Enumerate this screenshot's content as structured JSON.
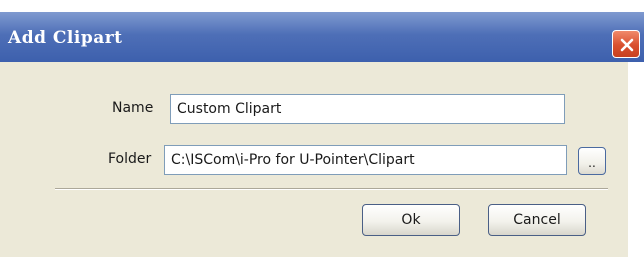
{
  "dialog": {
    "title": "Add Clipart",
    "close_icon": "close-icon",
    "name_label": "Name",
    "name_value": "Custom Clipart",
    "folder_label": "Folder",
    "folder_value": "C:\\ISCom\\i-Pro for U-Pointer\\Clipart",
    "browse_label": "..",
    "ok_label": "Ok",
    "cancel_label": "Cancel"
  },
  "colors": {
    "titlebar": "#3d60ad",
    "close_button": "#d9502f",
    "dialog_body": "#ece9d8"
  }
}
